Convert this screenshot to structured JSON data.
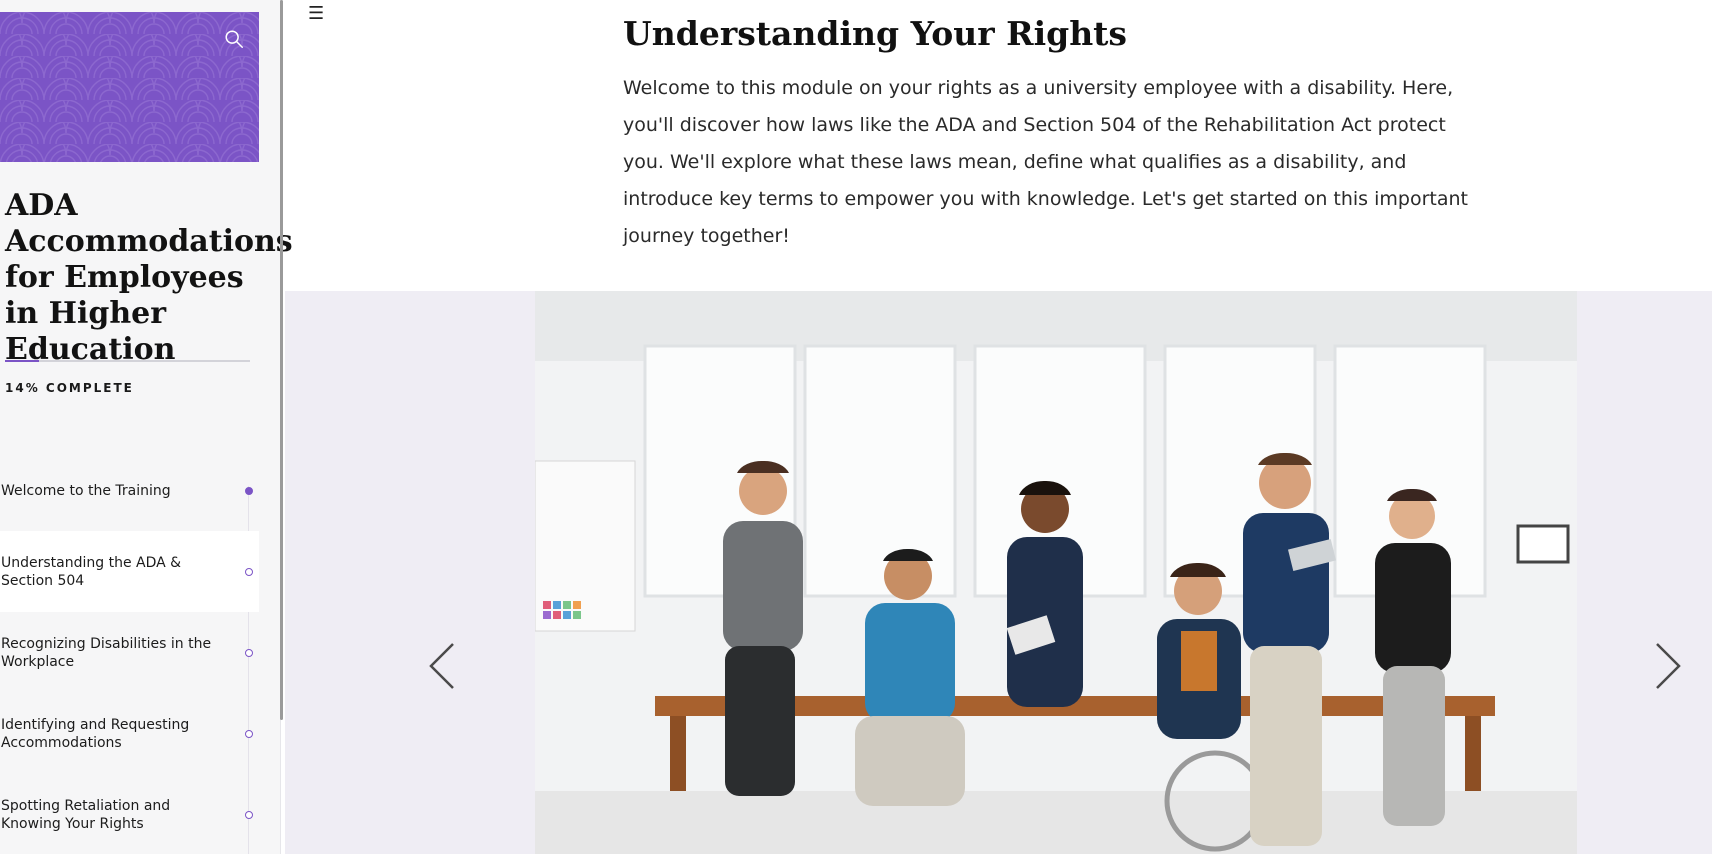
{
  "sidebar": {
    "course_title": "ADA Accommodations for Employees in Higher Education",
    "progress": {
      "percent": 14,
      "label": "14% COMPLETE"
    },
    "lessons": [
      {
        "label": "Welcome to the Training",
        "status": "complete"
      },
      {
        "label": "Understanding the ADA & Section 504",
        "status": "current"
      },
      {
        "label": "Recognizing Disabilities in the Workplace",
        "status": "incomplete"
      },
      {
        "label": "Identifying and Requesting Accommodations",
        "status": "incomplete"
      },
      {
        "label": "Spotting Retaliation and Knowing Your Rights",
        "status": "incomplete"
      }
    ]
  },
  "main": {
    "title": "Understanding Your Rights",
    "intro": "Welcome to this module on your rights as a university employee with a disability. Here, you'll discover how laws like the ADA and Section 504 of the Rehabilitation Act protect you. We'll explore what these laws mean, define what qualifies as a disability, and introduce key terms to empower you with knowledge. Let's get started on this important journey together!"
  },
  "colors": {
    "accent": "#7b54c6",
    "sidebar_bg": "#f6f6f7",
    "carousel_bg": "#efedf4"
  },
  "icons": {
    "search": "search-icon",
    "menu": "hamburger-icon",
    "prev": "chevron-left-icon",
    "next": "chevron-right-icon"
  }
}
